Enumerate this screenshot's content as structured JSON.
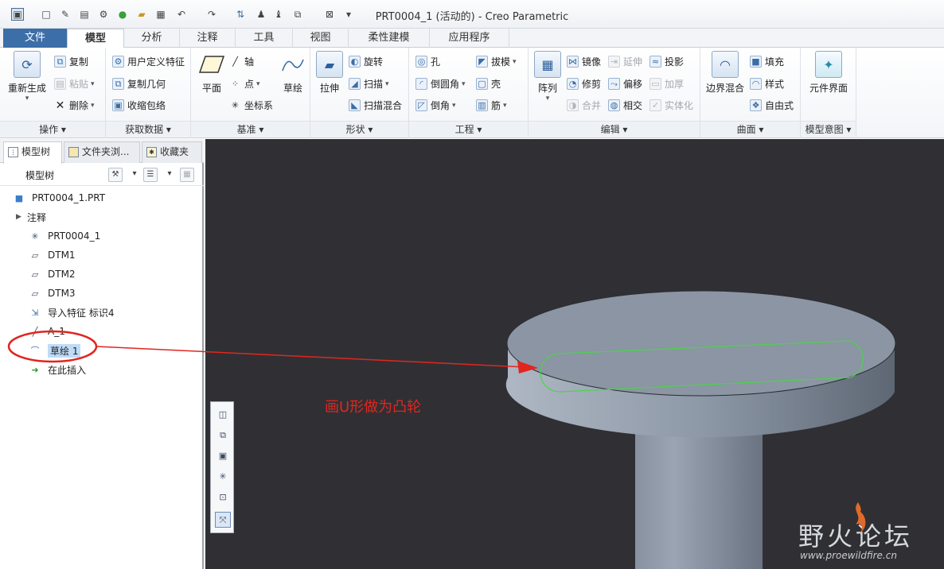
{
  "window": {
    "title": "PRT0004_1 (活动的) - Creo Parametric"
  },
  "qat_icons": [
    "app-icon",
    "new-icon",
    "open-icon",
    "save-icon",
    "regen-icon",
    "folder-icon",
    "save-as-icon",
    "undo-icon",
    "redo-icon",
    "regenerate-icon",
    "window-icon",
    "close-window-icon",
    "customize-icon"
  ],
  "tabs": [
    {
      "label": "文件"
    },
    {
      "label": "模型"
    },
    {
      "label": "分析"
    },
    {
      "label": "注释"
    },
    {
      "label": "工具"
    },
    {
      "label": "视图"
    },
    {
      "label": "柔性建模"
    },
    {
      "label": "应用程序"
    }
  ],
  "ribbon": {
    "ops": {
      "regen": "重新生成",
      "copy": "复制",
      "paste": "粘贴",
      "delete": "删除",
      "label": "操作"
    },
    "getdata": {
      "udf": "用户定义特征",
      "copygeom": "复制几何",
      "shrinkwrap": "收缩包络",
      "label": "获取数据"
    },
    "datum": {
      "plane": "平面",
      "axis": "轴",
      "point": "点",
      "csys": "坐标系",
      "sketch": "草绘",
      "label": "基准"
    },
    "shapes": {
      "extrude": "拉伸",
      "revolve": "旋转",
      "sweep": "扫描",
      "sweepblend": "扫描混合",
      "label": "形状"
    },
    "engineering": {
      "hole": "孔",
      "draft": "拔模",
      "round": "倒圆角",
      "shell": "壳",
      "chamfer": "倒角",
      "rib": "筋",
      "label": "工程"
    },
    "editing": {
      "pattern": "阵列",
      "mirror": "镜像",
      "extend": "延伸",
      "project": "投影",
      "trim": "修剪",
      "offset": "偏移",
      "thicken": "加厚",
      "merge": "合并",
      "intersect": "相交",
      "solidify": "实体化",
      "label": "编辑"
    },
    "surfaces": {
      "boundary": "边界混合",
      "fill": "填充",
      "style": "样式",
      "freestyle": "自由式",
      "label": "曲面"
    },
    "intent": {
      "component": "元件界面",
      "label": "模型意图"
    }
  },
  "panel": {
    "tabs": [
      {
        "label": "模型树"
      },
      {
        "label": "文件夹浏..."
      },
      {
        "label": "收藏夹"
      }
    ],
    "tree_title": "模型树",
    "items": [
      {
        "label": "PRT0004_1.PRT"
      },
      {
        "label": "注释"
      },
      {
        "label": "PRT0004_1"
      },
      {
        "label": "DTM1"
      },
      {
        "label": "DTM2"
      },
      {
        "label": "DTM3"
      },
      {
        "label": "导入特征 标识4"
      },
      {
        "label": "A_1"
      },
      {
        "label": "草绘 1"
      },
      {
        "label": "在此插入"
      }
    ]
  },
  "annotation": {
    "text": "画U形做为凸轮"
  },
  "watermark": {
    "title": "野火论坛",
    "url": "www.proewildfire.cn"
  },
  "colors": {
    "accent": "#3c6ea8",
    "viewport": "#303034",
    "annotation": "#e0261f",
    "highlight": "#bfdcf7"
  }
}
